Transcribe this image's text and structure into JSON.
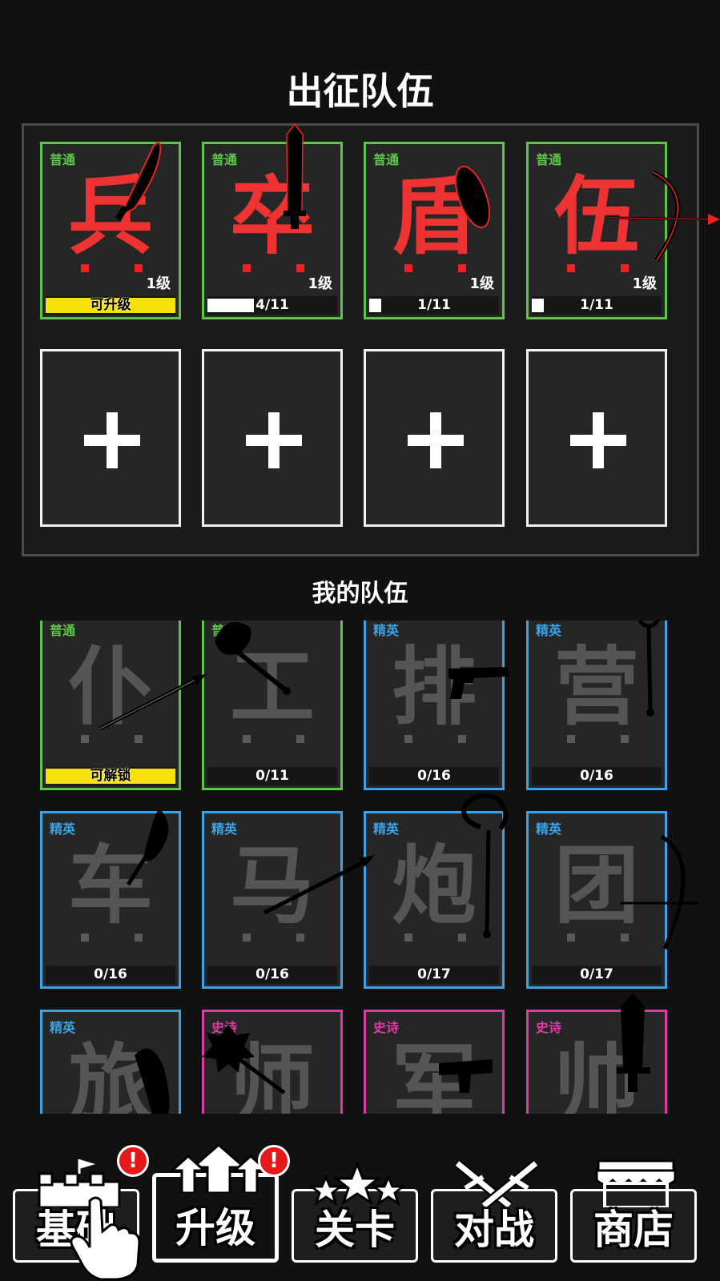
{
  "deploy": {
    "title": "出征队伍",
    "cards": [
      {
        "rarity": "普通",
        "glyph": "兵",
        "level": "1级",
        "progress": "可升级",
        "fill": 1.0,
        "upgradeable": true,
        "weapon": "scimitar-icon"
      },
      {
        "rarity": "普通",
        "glyph": "卒",
        "level": "1级",
        "progress": "4/11",
        "fill": 0.36,
        "upgradeable": false,
        "weapon": "broadsword-icon"
      },
      {
        "rarity": "普通",
        "glyph": "盾",
        "level": "1级",
        "progress": "1/11",
        "fill": 0.09,
        "upgradeable": false,
        "weapon": "shield-icon"
      },
      {
        "rarity": "普通",
        "glyph": "伍",
        "level": "1级",
        "progress": "1/11",
        "fill": 0.09,
        "upgradeable": false,
        "weapon": "bow-icon"
      }
    ],
    "empty_slot_icon": "plus-icon"
  },
  "roster": {
    "title": "我的队伍",
    "cards": [
      {
        "rarity": "普通",
        "rarity_class": "common",
        "glyph": "仆",
        "progress": "可解锁",
        "fill": 1.0,
        "unlockable": true,
        "weapon": "spear-icon"
      },
      {
        "rarity": "普通",
        "rarity_class": "common",
        "glyph": "工",
        "progress": "0/11",
        "fill": 0,
        "unlockable": false,
        "weapon": "battle-axe-icon"
      },
      {
        "rarity": "精英",
        "rarity_class": "elite",
        "glyph": "排",
        "progress": "0/16",
        "fill": 0,
        "unlockable": false,
        "weapon": "pistol-icon"
      },
      {
        "rarity": "精英",
        "rarity_class": "elite",
        "glyph": "营",
        "progress": "0/16",
        "fill": 0,
        "unlockable": false,
        "weapon": "ring-staff-icon"
      },
      {
        "rarity": "精英",
        "rarity_class": "elite",
        "glyph": "车",
        "progress": "0/16",
        "fill": 0,
        "unlockable": false,
        "weapon": "glaive-icon"
      },
      {
        "rarity": "精英",
        "rarity_class": "elite",
        "glyph": "马",
        "progress": "0/16",
        "fill": 0,
        "unlockable": false,
        "weapon": "lance-icon"
      },
      {
        "rarity": "精英",
        "rarity_class": "elite",
        "glyph": "炮",
        "progress": "0/17",
        "fill": 0,
        "unlockable": false,
        "weapon": "hook-staff-icon"
      },
      {
        "rarity": "精英",
        "rarity_class": "elite",
        "glyph": "团",
        "progress": "0/17",
        "fill": 0,
        "unlockable": false,
        "weapon": "bow-icon"
      },
      {
        "rarity": "精英",
        "rarity_class": "elite",
        "glyph": "旅",
        "progress": "",
        "fill": 0,
        "unlockable": false,
        "weapon": "machete-icon"
      },
      {
        "rarity": "史诗",
        "rarity_class": "epic",
        "glyph": "师",
        "progress": "",
        "fill": 0,
        "unlockable": false,
        "weapon": "morning-star-icon"
      },
      {
        "rarity": "史诗",
        "rarity_class": "epic",
        "glyph": "军",
        "progress": "",
        "fill": 0,
        "unlockable": false,
        "weapon": "smg-icon"
      },
      {
        "rarity": "史诗",
        "rarity_class": "epic",
        "glyph": "帅",
        "progress": "",
        "fill": 0,
        "unlockable": false,
        "weapon": "greatsword-icon"
      }
    ]
  },
  "nav": {
    "items": [
      {
        "label": "基础",
        "icon": "castle-icon",
        "badge": "!",
        "selected": false
      },
      {
        "label": "升级",
        "icon": "upgrade-arrows-icon",
        "badge": "!",
        "selected": true
      },
      {
        "label": "关卡",
        "icon": "stars-icon",
        "badge": "",
        "selected": false
      },
      {
        "label": "对战",
        "icon": "crossed-swords-icon",
        "badge": "",
        "selected": false
      },
      {
        "label": "商店",
        "icon": "shop-awning-icon",
        "badge": "",
        "selected": false
      }
    ],
    "hint_icon": "tap-hand-icon"
  },
  "colors": {
    "background": "#111111",
    "common": "#5ec44a",
    "elite": "#3aa2e6",
    "epic": "#dd3aa6",
    "active_glyph": "#ee3333",
    "progress_ready": "#f6e20a",
    "badge": "#e51919"
  }
}
